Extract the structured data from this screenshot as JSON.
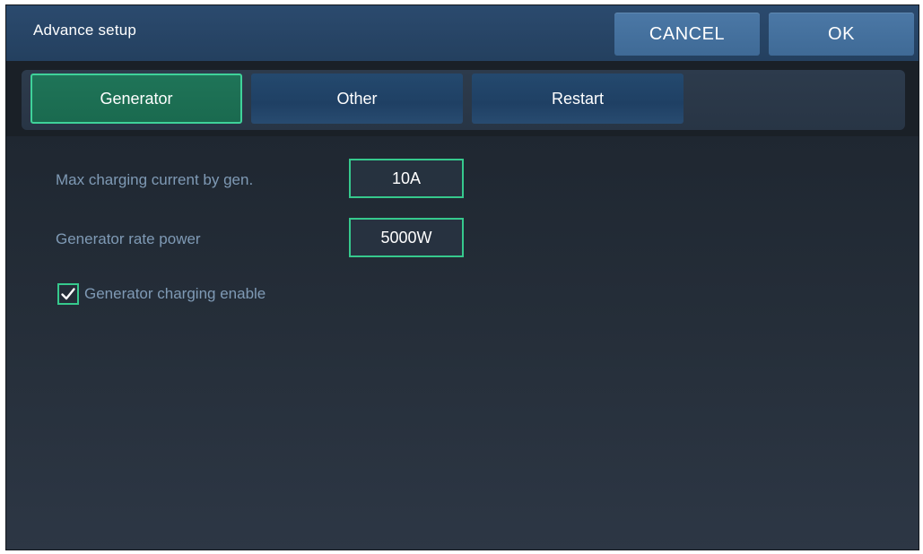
{
  "header": {
    "title": "Advance setup",
    "cancel_label": "CANCEL",
    "ok_label": "OK"
  },
  "tabs": [
    {
      "label": "Generator",
      "active": true
    },
    {
      "label": "Other",
      "active": false
    },
    {
      "label": "Restart",
      "active": false
    }
  ],
  "generator": {
    "max_charging_current": {
      "label": "Max charging current by gen.",
      "value": "10A"
    },
    "rate_power": {
      "label": "Generator rate power",
      "value": "5000W"
    },
    "charging_enable": {
      "label": "Generator charging enable",
      "checked": true
    }
  },
  "colors": {
    "accent": "#36c98d",
    "header_bg": "#2b4a6e",
    "button_bg": "#4b78a6",
    "label_text": "#7f9ab5"
  },
  "icons": {
    "checkbox_mark": "check-icon"
  }
}
